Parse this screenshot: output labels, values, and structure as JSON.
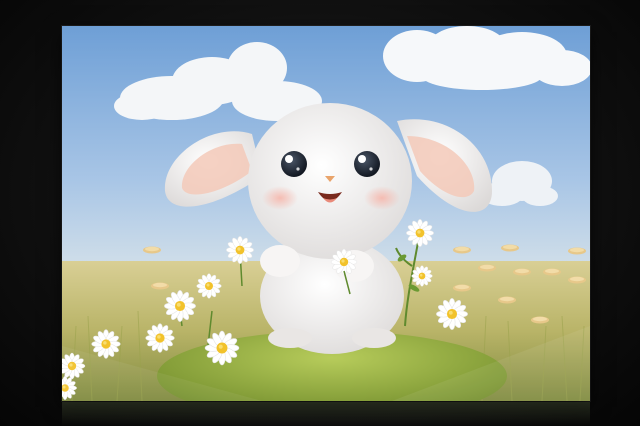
{
  "scene": {
    "subject": "white-bunny",
    "colors": {
      "sky_top": "#6e9fd6",
      "sky_bottom": "#c9dcec",
      "grass_light": "#c8c27a",
      "grass_dark": "#7f8a3e",
      "hill_green": "#9ab547",
      "fur": "#f4f2f1",
      "ear_inner": "#f3c9b9",
      "daisy_center": "#f2c22b"
    }
  }
}
